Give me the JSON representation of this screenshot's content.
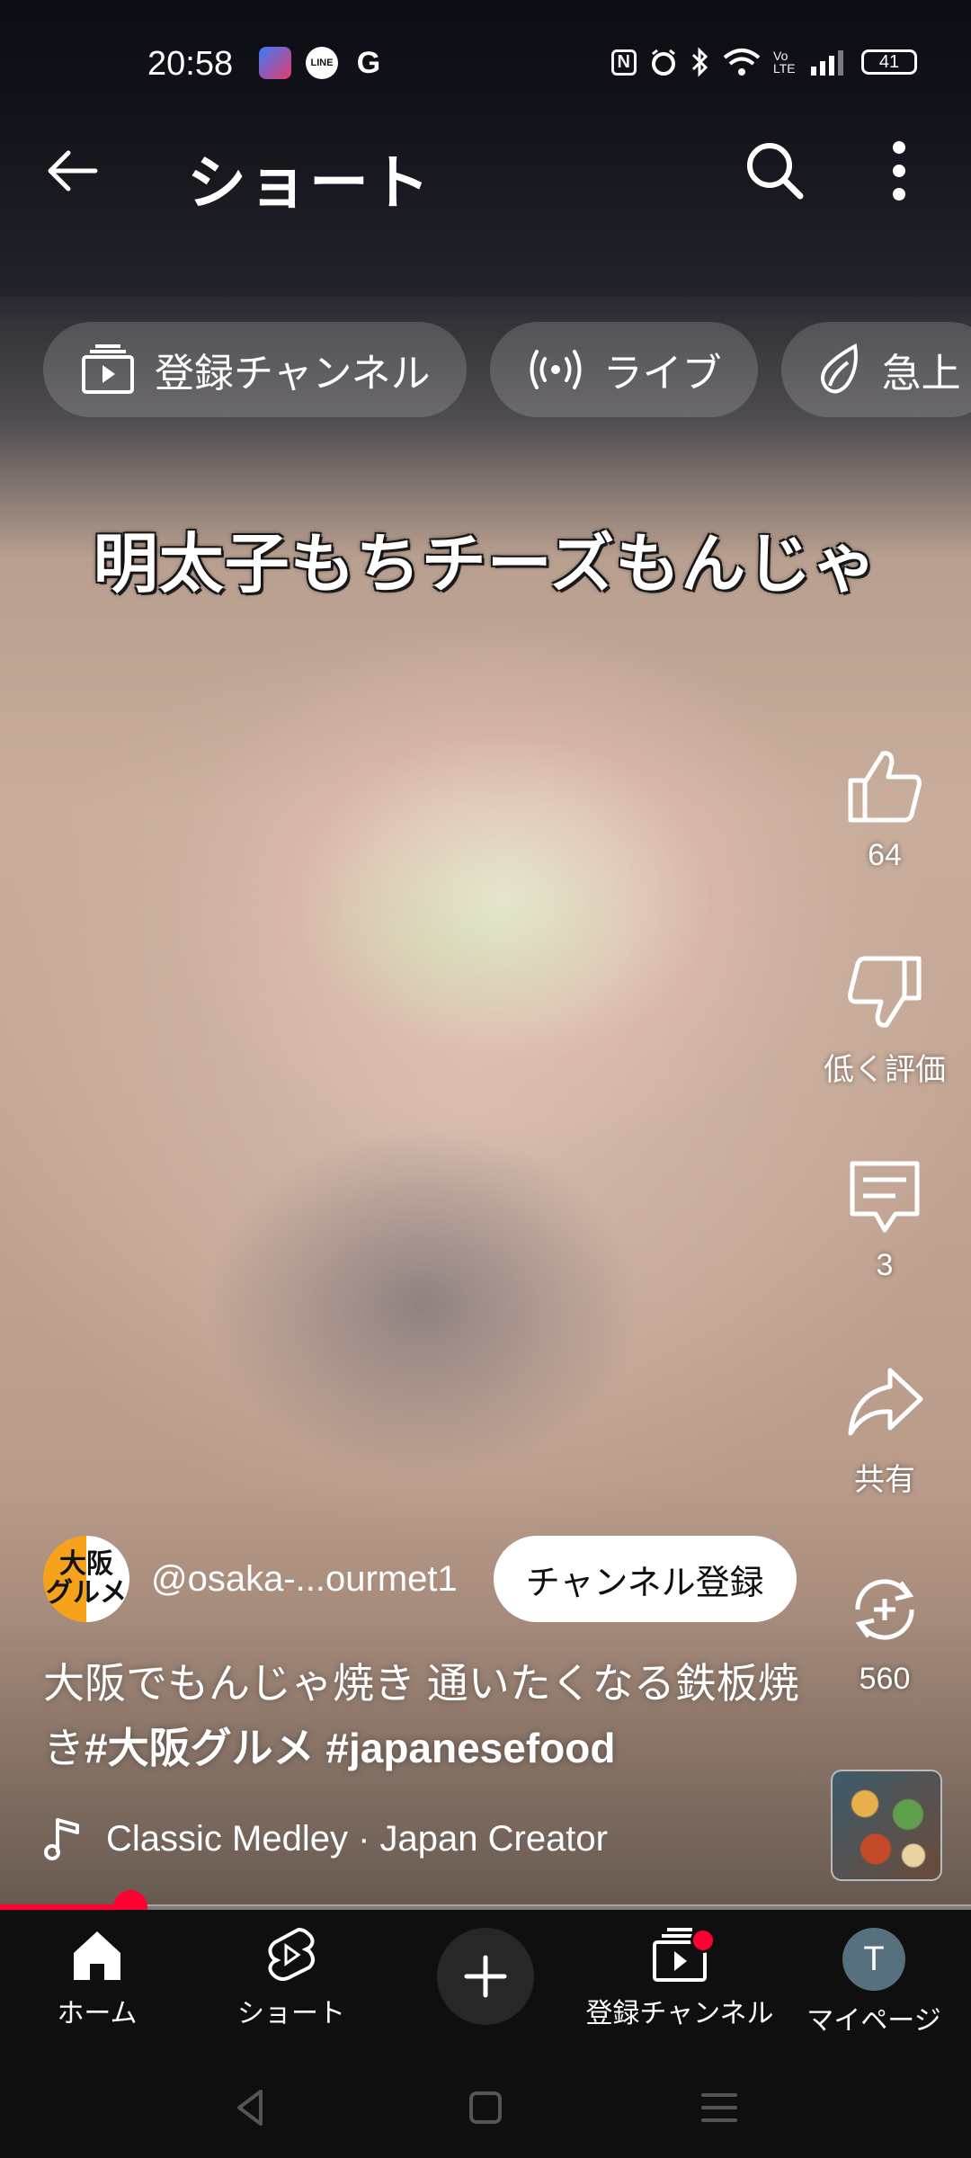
{
  "status_bar": {
    "time": "20:58",
    "app_icons": [
      "line-icon",
      "g-icon"
    ],
    "line_label": "LINE",
    "g_label": "G",
    "nfc_glyph": "N",
    "volte": "Vo LTE",
    "battery": "41"
  },
  "header": {
    "title": "ショート",
    "back_icon": "back-arrow-icon",
    "search_icon": "search-icon",
    "more_icon": "more-vert-icon"
  },
  "chips": [
    {
      "label": "登録チャンネル",
      "icon": "subscriptions-icon"
    },
    {
      "label": "ライブ",
      "icon": "live-icon"
    },
    {
      "label": "急上",
      "icon": "trending-icon"
    }
  ],
  "video": {
    "caption": "明太子もちチーズもんじゃ"
  },
  "actions": {
    "like_count": "64",
    "dislike_label": "低く評価",
    "comment_count": "3",
    "share_label": "共有",
    "remix_count": "560"
  },
  "channel": {
    "avatar_text": "大阪\nグルメ",
    "avatar_line1": "大阪",
    "avatar_line2": "グルメ",
    "handle": "@osaka-...ourmet1",
    "subscribe_label": "チャンネル登録"
  },
  "description": {
    "text": "大阪でもんじゃ焼き 通いたくなる鉄板焼き",
    "hashtag1": "#大阪グルメ",
    "hashtag2": "#japanesefood"
  },
  "music": {
    "label": "Classic Medley · Japan Creator",
    "icon": "music-note-icon"
  },
  "progress": {
    "fraction": 0.134
  },
  "bottom_nav": {
    "home": "ホーム",
    "shorts": "ショート",
    "create_icon": "plus-icon",
    "subscriptions": "登録チャンネル",
    "you": "マイページ",
    "account_initial": "T"
  },
  "colors": {
    "accent": "#ff0033",
    "background": "#0f0f0f",
    "chip": "rgba(255,255,255,0.16)"
  }
}
